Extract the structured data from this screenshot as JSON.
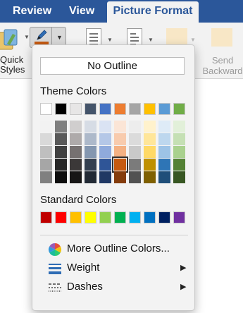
{
  "ribbon": {
    "tabs": [
      {
        "label": "Review",
        "active": false
      },
      {
        "label": "View",
        "active": false
      },
      {
        "label": "Picture Format",
        "active": true
      }
    ],
    "quick_styles_label": "Quick Styles",
    "send_backward_label": "Send Backward",
    "accent_color": "#2b579a"
  },
  "outline_menu": {
    "no_outline_label": "No Outline",
    "theme_colors_title": "Theme Colors",
    "theme_base_colors": [
      "#ffffff",
      "#000000",
      "#e7e6e6",
      "#44546a",
      "#4472c4",
      "#ed7d31",
      "#a5a5a5",
      "#ffc000",
      "#5b9bd5",
      "#70ad47"
    ],
    "theme_shades": [
      [
        "#f2f2f2",
        "#d9d9d9",
        "#bfbfbf",
        "#a6a6a6",
        "#808080"
      ],
      [
        "#7f7f7f",
        "#595959",
        "#404040",
        "#262626",
        "#0d0d0d"
      ],
      [
        "#d0cece",
        "#aeaaaa",
        "#767171",
        "#3b3838",
        "#171616"
      ],
      [
        "#d6dce5",
        "#adb9ca",
        "#8497b0",
        "#333f50",
        "#222a35"
      ],
      [
        "#dae3f3",
        "#b4c7e7",
        "#8faadc",
        "#2f5597",
        "#203864"
      ],
      [
        "#fbe5d6",
        "#f8cbad",
        "#f4b183",
        "#c55a11",
        "#843c0c"
      ],
      [
        "#ededed",
        "#dbdbdb",
        "#c9c9c9",
        "#7b7b7b",
        "#525252"
      ],
      [
        "#fff2cc",
        "#ffe699",
        "#ffd966",
        "#bf9000",
        "#7f6000"
      ],
      [
        "#deebf7",
        "#bdd7ee",
        "#9dc3e6",
        "#2e75b6",
        "#1f4e79"
      ],
      [
        "#e2f0d9",
        "#c5e0b4",
        "#a9d18e",
        "#548235",
        "#385723"
      ]
    ],
    "selected_color": "#c55a11",
    "standard_colors_title": "Standard Colors",
    "standard_colors": [
      "#c00000",
      "#ff0000",
      "#ffc000",
      "#ffff00",
      "#92d050",
      "#00b050",
      "#00b0f0",
      "#0070c0",
      "#002060",
      "#7030a0"
    ],
    "items": [
      {
        "label": "More Outline Colors...",
        "icon": "color-wheel-icon",
        "has_submenu": false
      },
      {
        "label": "Weight",
        "icon": "line-weight-icon",
        "has_submenu": true
      },
      {
        "label": "Dashes",
        "icon": "dashes-icon",
        "has_submenu": true
      }
    ]
  }
}
